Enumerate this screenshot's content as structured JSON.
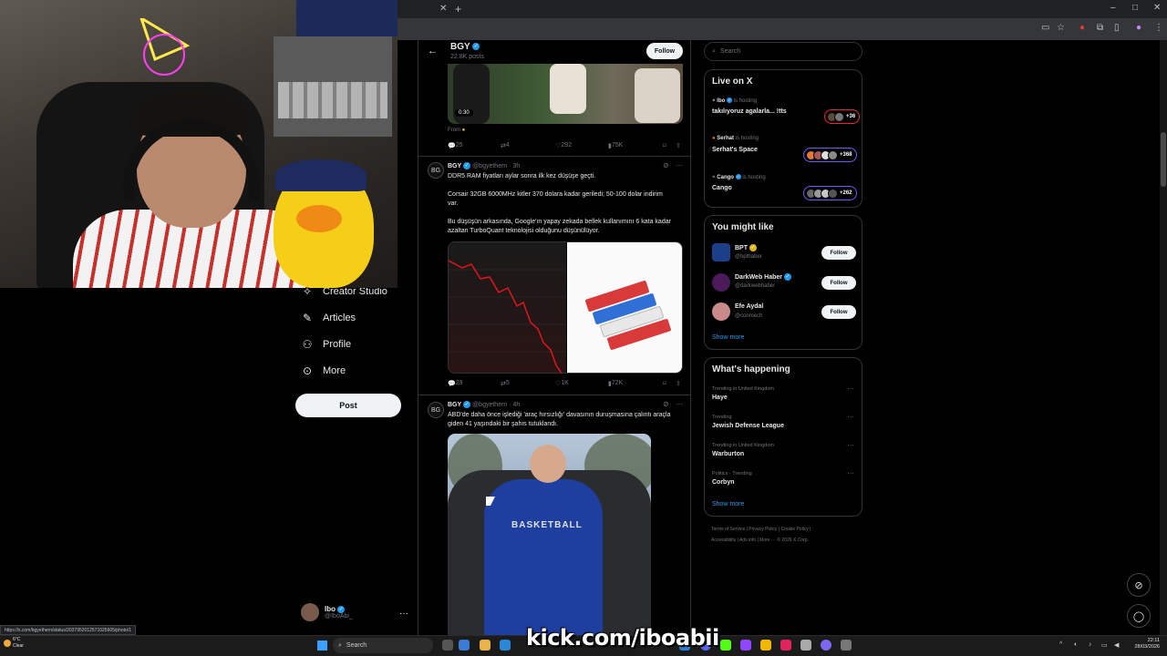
{
  "browser": {
    "window_controls": [
      "–",
      "□",
      "✕"
    ]
  },
  "left_nav": {
    "items": [
      {
        "label": "Creator Studio",
        "icon": "creator-studio-icon"
      },
      {
        "label": "Articles",
        "icon": "articles-icon"
      },
      {
        "label": "Profile",
        "icon": "profile-icon"
      },
      {
        "label": "More",
        "icon": "more-icon"
      }
    ],
    "post_label": "Post",
    "account": {
      "name": "Ibo",
      "handle": "@IboAbi_"
    }
  },
  "profile_header": {
    "name": "BGY",
    "posts": "22.8K posts",
    "follow_label": "Follow"
  },
  "tweets": [
    {
      "video_duration": "0:30",
      "from_label": "From",
      "replies": "25",
      "reposts": "4",
      "likes": "292",
      "views": "75K"
    },
    {
      "name": "BGY",
      "handle": "@bgyethern · 3h",
      "text1": "DDR5 RAM fiyatları aylar sonra ilk kez düşüşe geçti.",
      "text2": "Corsair 32GB 6000MHz kitler 370 dolara kadar geriledi; 50-100 dolar indirim var.",
      "text3": "Bu düşüşün arkasında, Google'ın yapay zekada bellek kullanımını 6 kata kadar azaltan TurboQuant teknolojisi olduğunu düşünülüyor.",
      "replies": "29",
      "reposts": "5",
      "likes": "1K",
      "views": "72K"
    },
    {
      "name": "BGY",
      "handle": "@bgyethern · 4h",
      "text1": "ABD'de daha önce işlediği 'araç hırsızlığı' davasının duruşmasına çalıntı araçla giden 41 yaşındaki bir şahıs tutuklandı.",
      "image_text": "BASKETBALL"
    }
  ],
  "right_sidebar": {
    "search_placeholder": "Search",
    "live": {
      "title": "Live on X",
      "items": [
        {
          "host": "Ibo",
          "status": "is hosting",
          "title": "takılıyoruz agalarla... !tts",
          "count": "+36"
        },
        {
          "host": "Serhat",
          "status": "is hosting",
          "title": "Serhat's Space",
          "count": "+368"
        },
        {
          "host": "Cango",
          "status": "is hosting",
          "title": "Cango",
          "count": "+262"
        }
      ]
    },
    "you_might_like": {
      "title": "You might like",
      "items": [
        {
          "name": "BPT",
          "handle": "@bpthaber",
          "button": "Follow"
        },
        {
          "name": "DarkWeb Haber",
          "handle": "@darkwebhaber",
          "button": "Follow"
        },
        {
          "name": "Efe Aydal",
          "handle": "@conmech",
          "button": "Follow"
        }
      ],
      "show_more": "Show more"
    },
    "whats_happening": {
      "title": "What's happening",
      "items": [
        {
          "context": "Trending in United Kingdom",
          "name": "Haye"
        },
        {
          "context": "Trending",
          "name": "Jewish Defense League"
        },
        {
          "context": "Trending in United Kingdom",
          "name": "Warburton"
        },
        {
          "context": "Politics · Trending",
          "name": "Corbyn"
        }
      ],
      "show_more": "Show more"
    },
    "footer": {
      "line1": "Terms of Service  |  Privacy Policy  |  Cookie Policy  |",
      "line2": "Accessibility  |  Ads info  |  More ···  © 2026 X Corp."
    }
  },
  "status_url": "https://x.com/bgyethern/status/2037952012571025605/photo/1",
  "stream_overlay": "kick.com/iboabii",
  "taskbar": {
    "weather_temp": "6°C",
    "weather_desc": "Clear",
    "search_label": "Search",
    "time": "22:11",
    "date": "28/03/2026"
  },
  "colors": {
    "accent": "#1d9bf0",
    "background": "#000000",
    "border": "#2f3336"
  }
}
